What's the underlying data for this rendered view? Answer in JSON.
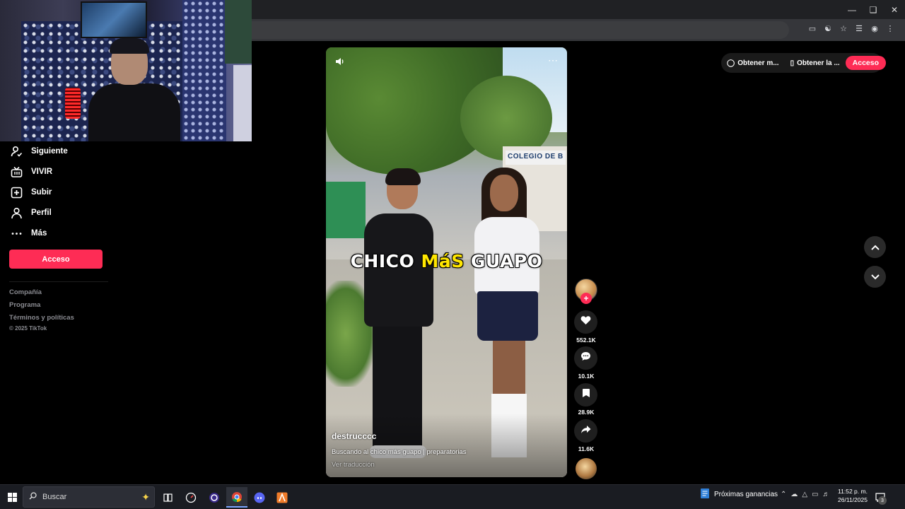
{
  "sidebar": {
    "items": [
      {
        "label": "Siguiente",
        "icon": "following-icon"
      },
      {
        "label": "VIVIR",
        "icon": "live-icon"
      },
      {
        "label": "Subir",
        "icon": "upload-icon"
      },
      {
        "label": "Perfil",
        "icon": "profile-icon"
      },
      {
        "label": "Más",
        "icon": "more-icon"
      }
    ],
    "login_label": "Acceso",
    "footer_links": [
      "Compañía",
      "Programa",
      "Términos y políticas"
    ],
    "copyright": "© 2025 TikTok"
  },
  "top_actions": {
    "get_coins": "Obtener m...",
    "get_app": "Obtener la ...",
    "login": "Acceso"
  },
  "video": {
    "caption_part1": "CHICO ",
    "caption_highlight": "MáS",
    "caption_part2": " GUAPO",
    "author": "destrucccc",
    "description": "Buscando al chico más guapo | preparatorias",
    "translate": "Ver traducción",
    "sign_text": "COLEGIO DE B"
  },
  "actions": {
    "likes": "552.1K",
    "comments": "10.1K",
    "saves": "28.9K",
    "shares": "11.6K"
  },
  "taskbar": {
    "search_placeholder": "Buscar",
    "weather_text": "Próximas ganancias",
    "time": "11:52 p. m.",
    "date": "26/11/2025",
    "notification_count": "3"
  },
  "colors": {
    "accent": "#fe2c55",
    "caption_highlight": "#ffe600"
  }
}
